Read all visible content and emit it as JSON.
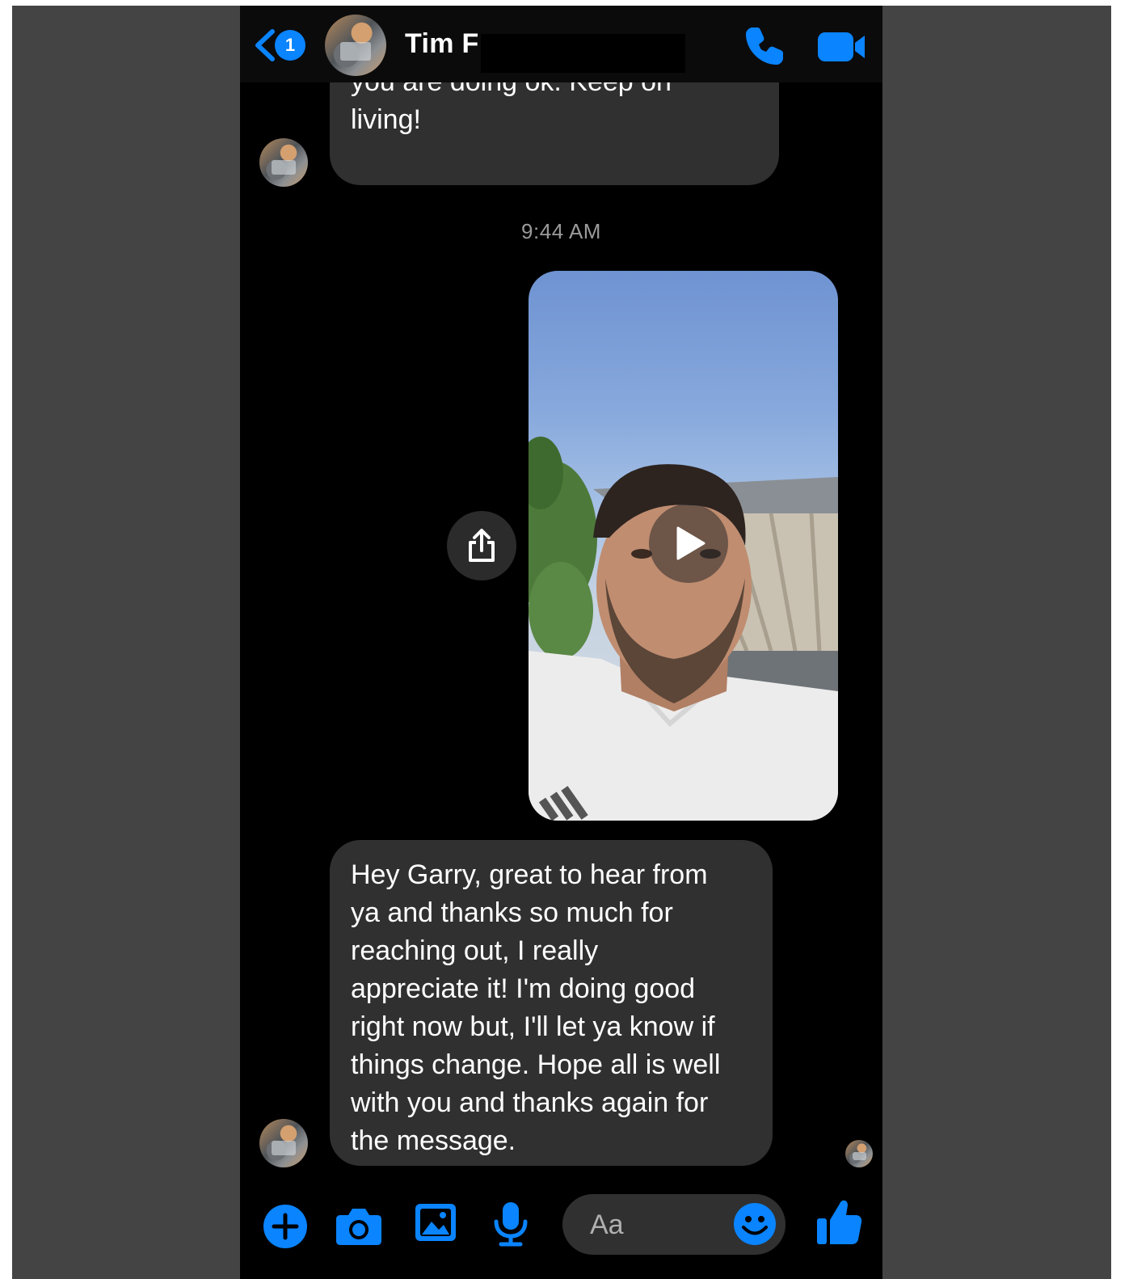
{
  "header": {
    "unread_count": "1",
    "contact_name": "Tim F"
  },
  "messages": {
    "first_partial_text": "What!  Wow, well it sounds like\nyou are doing ok. Keep on\nliving!",
    "timestamp": "9:44 AM",
    "reply_text": "Hey Garry, great to hear from\nya and thanks so much for\nreaching out, I really\nappreciate it!  I'm doing good\nright now but, I'll let ya know if\nthings change. Hope all is well\nwith you and thanks again for\nthe message."
  },
  "composer": {
    "placeholder": "Aa"
  },
  "colors": {
    "accent": "#0a84ff",
    "bubble": "#303030",
    "background": "#000000"
  }
}
